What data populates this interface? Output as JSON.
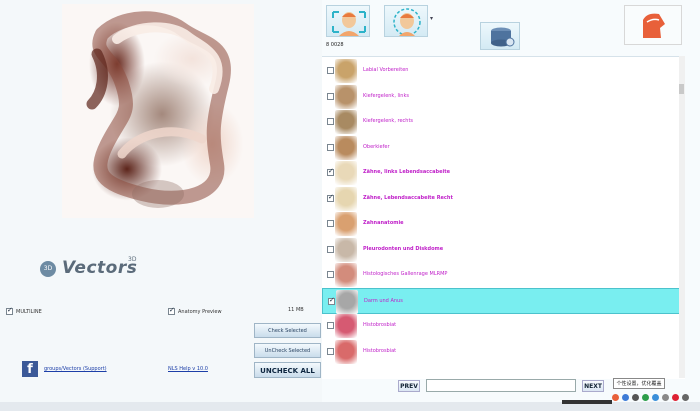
{
  "left": {
    "logo": {
      "text": "Vectors",
      "superscript": "3D"
    },
    "multiline": {
      "label": "MULTILINE",
      "checked": true
    },
    "anatomy_preview": {
      "label": "Anatomy Preview",
      "checked": true
    },
    "size_label": "11 MB",
    "buttons": {
      "check_selected": "Check Selected",
      "uncheck_selected": "UnCheck Selected",
      "uncheck_all": "UNCHECK ALL"
    },
    "facebook": {
      "icon": "facebook-icon",
      "link": "groups/Vectors (Support)"
    },
    "help_link": "NLS Help v 10.0"
  },
  "right": {
    "count_label": "8 0028",
    "list_items": [
      {
        "label": "Labial Vorbereiten",
        "checked": false,
        "bold": false,
        "thumb": "#c9a36a",
        "selected": false
      },
      {
        "label": "Kiefergelenk, links",
        "checked": false,
        "bold": false,
        "thumb": "#b8926a",
        "selected": false
      },
      {
        "label": "Kiefergelenk, rechts",
        "checked": false,
        "bold": false,
        "thumb": "#a88a62",
        "selected": false
      },
      {
        "label": "Oberkiefer",
        "checked": false,
        "bold": false,
        "thumb": "#b98b5e",
        "selected": false
      },
      {
        "label": "Zähne, links Lebendsaccabeite",
        "checked": true,
        "bold": true,
        "thumb": "#e9d9b8",
        "selected": false
      },
      {
        "label": "Zähne, Lebendsaccabeite Recht",
        "checked": true,
        "bold": true,
        "thumb": "#e6d6b0",
        "selected": false
      },
      {
        "label": "Zahnanatomie",
        "checked": false,
        "bold": true,
        "thumb": "#d9a070",
        "selected": false
      },
      {
        "label": "Pleurodonten und Diskdome",
        "checked": false,
        "bold": true,
        "thumb": "#c8b8a8",
        "selected": false
      },
      {
        "label": "Histologisches Gallenrage MLRMP",
        "checked": false,
        "bold": false,
        "thumb": "#d38c7c",
        "selected": false
      },
      {
        "label": "Darm und Anus",
        "checked": true,
        "bold": false,
        "thumb": "#a7a7a7",
        "selected": true
      },
      {
        "label": "Histobrosbiat",
        "checked": false,
        "bold": false,
        "thumb": "#d65a72",
        "selected": false
      },
      {
        "label": "Histobrosbiat",
        "checked": false,
        "bold": false,
        "thumb": "#d96a6a",
        "selected": false
      }
    ],
    "prev_label": "PREV",
    "next_label": "NEXT",
    "page_input_value": "",
    "tooltip": "个性设置，优化覆盖"
  },
  "colors": {
    "list_text": "#c021c9",
    "selected_row": "#79eef0",
    "button_text": "#1e3a5a"
  }
}
